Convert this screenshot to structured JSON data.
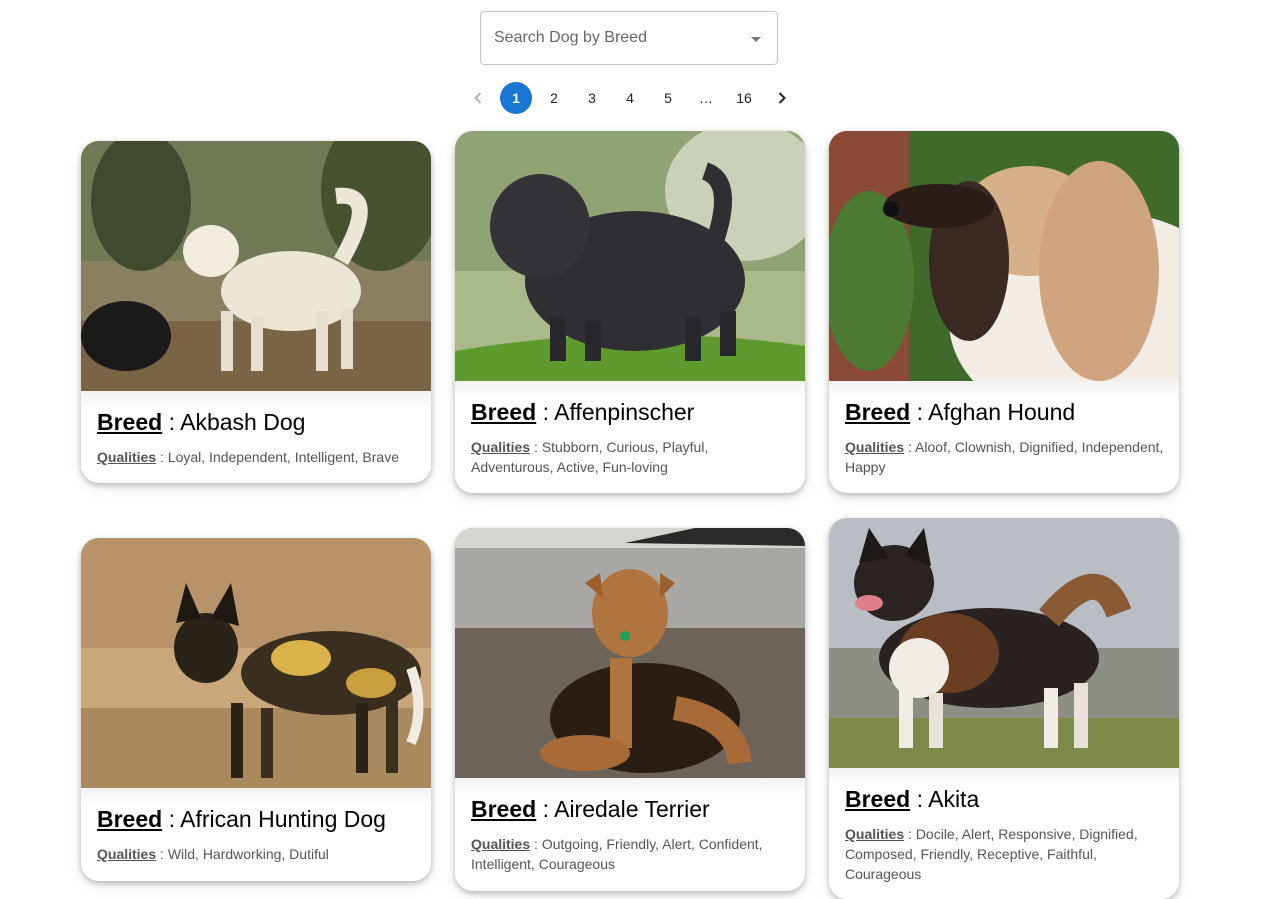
{
  "search": {
    "placeholder": "Search Dog by Breed",
    "icon": "dropdown-caret-icon"
  },
  "pagination": {
    "prev_icon": "chevron-left-icon",
    "next_icon": "chevron-right-icon",
    "pages": [
      "1",
      "2",
      "3",
      "4",
      "5",
      "…",
      "16"
    ],
    "current": "1",
    "accent_color": "#1976d2"
  },
  "labels": {
    "breed": "Breed",
    "qualities": "Qualities",
    "separator": " : "
  },
  "dogs": [
    {
      "breed": "Akbash Dog",
      "qualities": "Loyal, Independent, Intelligent, Brave"
    },
    {
      "breed": "Affenpinscher",
      "qualities": "Stubborn, Curious, Playful, Adventurous, Active, Fun-loving"
    },
    {
      "breed": "Afghan Hound",
      "qualities": "Aloof, Clownish, Dignified, Independent, Happy"
    },
    {
      "breed": "African Hunting Dog",
      "qualities": "Wild, Hardworking, Dutiful"
    },
    {
      "breed": "Airedale Terrier",
      "qualities": "Outgoing, Friendly, Alert, Confident, Intelligent, Courageous"
    },
    {
      "breed": "Akita",
      "qualities": "Docile, Alert, Responsive, Dignified, Composed, Friendly, Receptive, Faithful, Courageous"
    }
  ]
}
